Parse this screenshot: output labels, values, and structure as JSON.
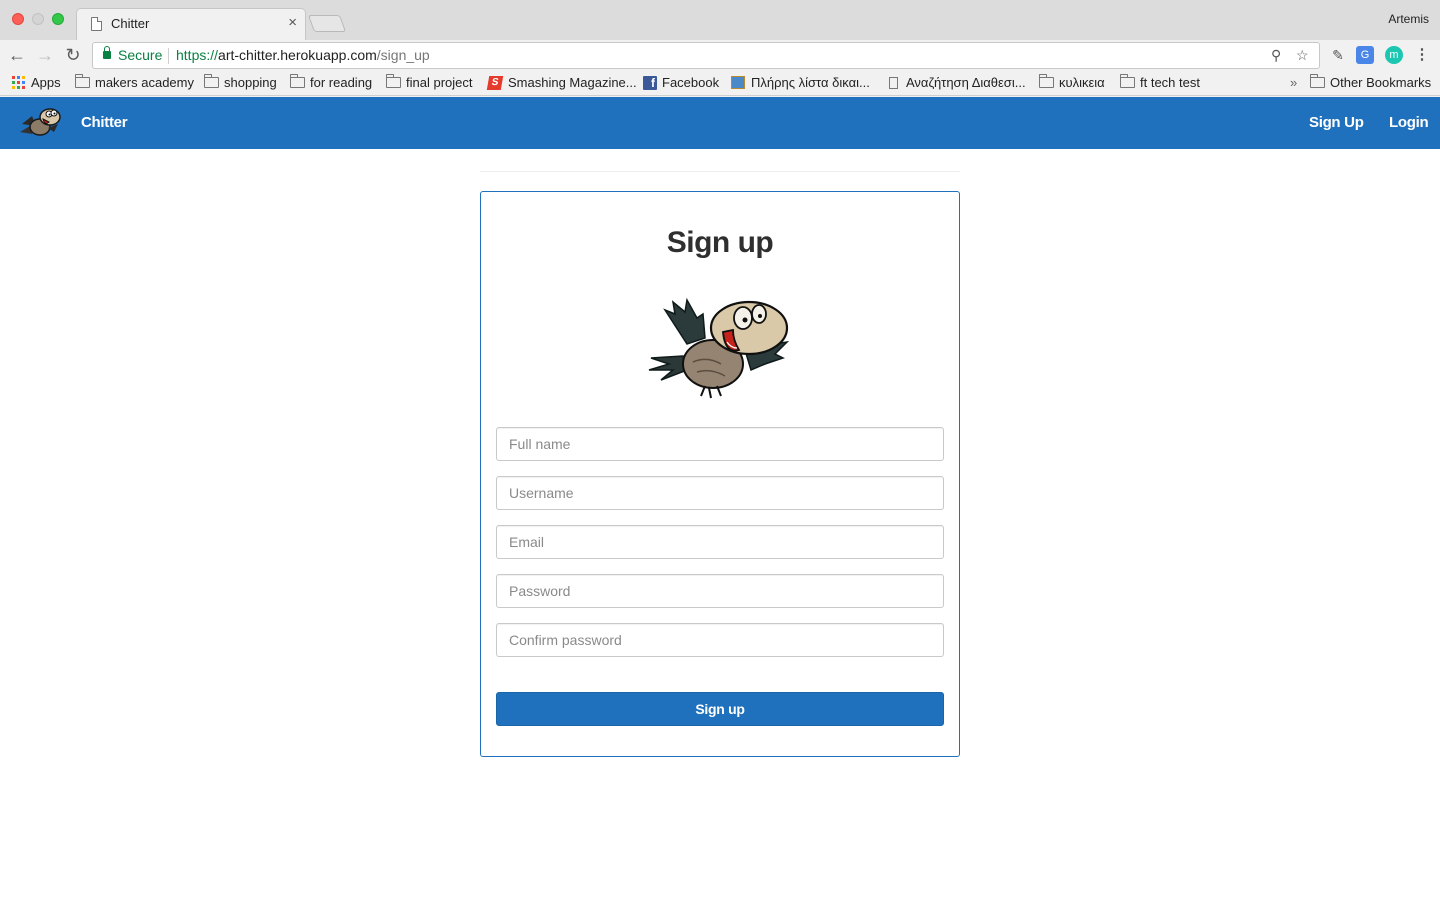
{
  "browser": {
    "tab_title": "Chitter",
    "tab_close": "×",
    "profile_name": "Artemis",
    "secure_label": "Secure",
    "url_scheme": "https://",
    "url_host": "art-chitter.herokuapp.com",
    "url_path": "/sign_up",
    "bookmarks": [
      {
        "label": "Apps",
        "icon": "apps-grid-icon"
      },
      {
        "label": "makers academy",
        "icon": "folder-icon"
      },
      {
        "label": "shopping",
        "icon": "folder-icon"
      },
      {
        "label": "for reading",
        "icon": "folder-icon"
      },
      {
        "label": "final project",
        "icon": "folder-icon"
      },
      {
        "label": "Smashing Magazine...",
        "icon": "smashing-icon"
      },
      {
        "label": "Facebook",
        "icon": "facebook-icon"
      },
      {
        "label": "Πλήρης λίστα δικαι...",
        "icon": "box-icon"
      },
      {
        "label": "Αναζήτηση Διαθεσι...",
        "icon": "page-icon"
      },
      {
        "label": "κυλικεια",
        "icon": "folder-icon"
      },
      {
        "label": "ft tech test",
        "icon": "folder-icon"
      }
    ],
    "bookmarks_overflow": "»",
    "other_bookmarks": "Other Bookmarks"
  },
  "navbar": {
    "brand": "Chitter",
    "signup_link": "Sign Up",
    "login_link": "Login",
    "color": "#2071bd"
  },
  "signup": {
    "title": "Sign up",
    "fields": {
      "full_name": "Full name",
      "username": "Username",
      "email": "Email",
      "password": "Password",
      "confirm_password": "Confirm password"
    },
    "submit_label": "Sign up"
  }
}
